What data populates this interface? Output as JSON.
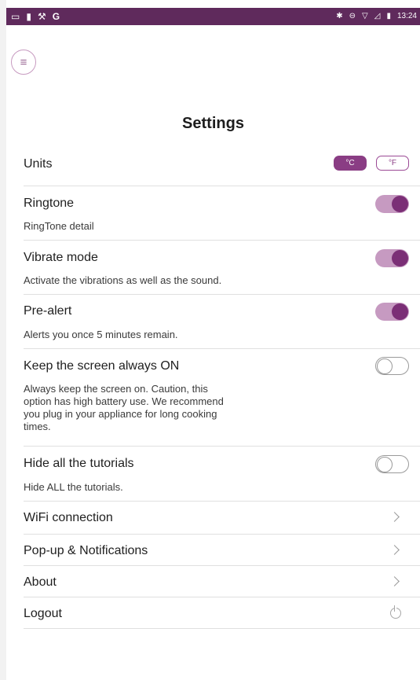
{
  "status_bar": {
    "left_icons": [
      "screen-icon",
      "battery-icon",
      "wrench-icon",
      "g-letter-icon"
    ],
    "right_icons": [
      "bluetooth-icon",
      "do-not-disturb-icon",
      "wifi-icon",
      "signal-icon",
      "battery-icon"
    ],
    "time": "13:24"
  },
  "header": {
    "menu_icon": "hamburger-menu-icon",
    "title": "Settings"
  },
  "units": {
    "label": "Units",
    "celsius": "°C",
    "fahrenheit": "°F",
    "selected": "celsius"
  },
  "settings": [
    {
      "title": "Ringtone",
      "desc": "RingTone detail",
      "on": true
    },
    {
      "title": "Vibrate mode",
      "desc": "Activate the vibrations as well as the sound.",
      "on": true
    },
    {
      "title": "Pre-alert",
      "desc": "Alerts you once 5 minutes remain.",
      "on": true
    },
    {
      "title": "Keep the screen always ON",
      "desc": "Always keep the screen on. Caution, this option has high battery use. We recommend you plug in your appliance for long cooking times.",
      "on": false
    },
    {
      "title": "Hide all the tutorials",
      "desc": "Hide ALL the tutorials.",
      "on": false
    }
  ],
  "links": [
    {
      "label": "WiFi connection",
      "icon": "chevron-right-icon"
    },
    {
      "label": "Pop-up & Notifications",
      "icon": "chevron-right-icon"
    },
    {
      "label": "About",
      "icon": "chevron-right-icon"
    },
    {
      "label": "Logout",
      "icon": "power-icon"
    }
  ],
  "colors": {
    "status_bar": "#5f2a5c",
    "accent": "#8a3d84",
    "toggle_track_on": "#c69ac1"
  }
}
